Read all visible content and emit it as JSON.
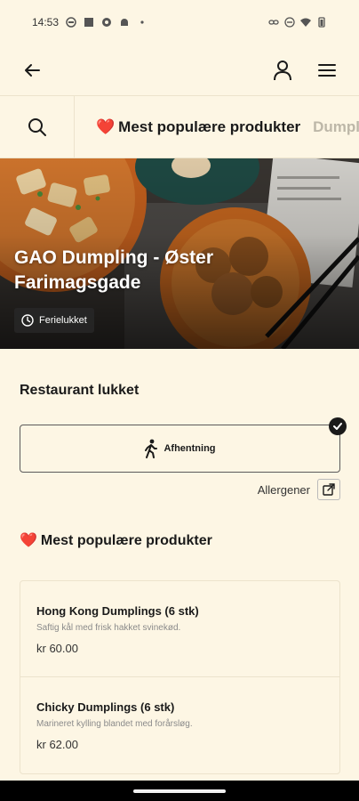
{
  "status_bar": {
    "time": "14:53"
  },
  "header": {
    "back_icon": "arrow-left-icon",
    "profile_icon": "user-icon",
    "menu_icon": "hamburger-menu-icon"
  },
  "categories": {
    "search_icon": "search-icon",
    "tabs": [
      {
        "emoji": "❤️",
        "label": "Mest populære produkter"
      },
      {
        "label": "Dumpli"
      }
    ]
  },
  "hero": {
    "title": "GAO Dumpling - Øster Farimagsgade",
    "badge": "Ferielukket",
    "badge_icon": "clock-icon"
  },
  "restaurant": {
    "status_heading": "Restaurant lukket",
    "mode_label": "Afhentning",
    "mode_icon": "walking-person-icon",
    "allergen_label": "Allergener"
  },
  "popular": {
    "emoji": "❤️",
    "heading": "Mest populære produkter",
    "products": [
      {
        "name": "Hong Kong Dumplings (6 stk)",
        "description": "Saftig kål med frisk hakket svinekød.",
        "price": "kr 60.00"
      },
      {
        "name": "Chicky Dumplings (6 stk)",
        "description": "Marineret kylling blandet med forårsløg.",
        "price": "kr 62.00"
      }
    ]
  },
  "colors": {
    "background": "#fdf6e4",
    "accent_heart": "#e0393e",
    "text": "#1a1a1a"
  }
}
